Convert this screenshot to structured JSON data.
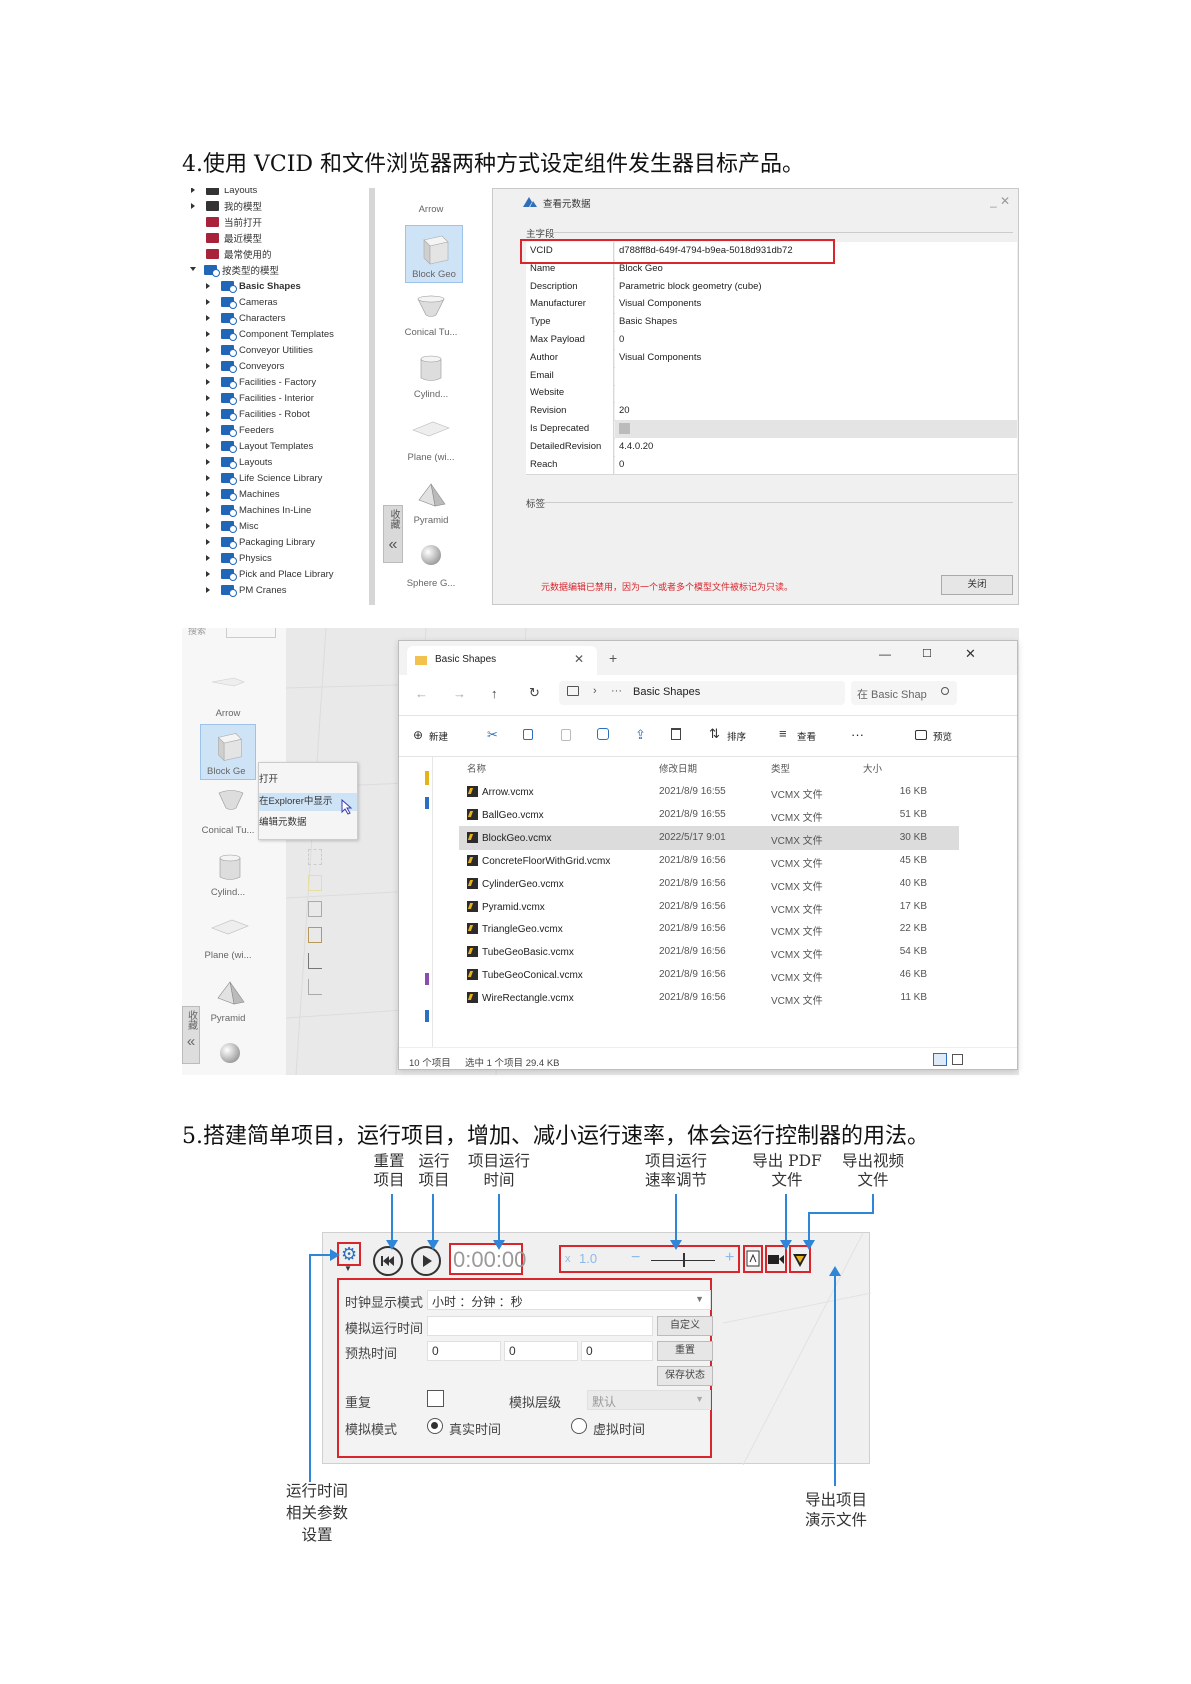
{
  "section4": {
    "heading": "4.使用 VCID 和文件浏览器两种方式设定组件发生器目标产品。",
    "tree": [
      {
        "label": "Layouts",
        "icon": "dark",
        "bold": false,
        "arrow": true
      },
      {
        "label": "我的模型",
        "icon": "dark",
        "bold": false,
        "arrow": true
      },
      {
        "label": "当前打开",
        "icon": "red",
        "bold": false,
        "arrow": false
      },
      {
        "label": "最近模型",
        "icon": "red",
        "bold": false,
        "arrow": false
      },
      {
        "label": "最常使用的",
        "icon": "red",
        "bold": false,
        "arrow": false
      },
      {
        "label": "按类型的模型",
        "icon": "blue",
        "bold": false,
        "arrow": "open"
      },
      {
        "label": "Basic Shapes",
        "icon": "blue",
        "bold": true,
        "arrow": true,
        "indent": true
      },
      {
        "label": "Cameras",
        "icon": "blue",
        "bold": false,
        "arrow": true,
        "indent": true
      },
      {
        "label": "Characters",
        "icon": "blue",
        "bold": false,
        "arrow": true,
        "indent": true
      },
      {
        "label": "Component Templates",
        "icon": "blue",
        "bold": false,
        "arrow": true,
        "indent": true
      },
      {
        "label": "Conveyor Utilities",
        "icon": "blue",
        "bold": false,
        "arrow": true,
        "indent": true
      },
      {
        "label": "Conveyors",
        "icon": "blue",
        "bold": false,
        "arrow": true,
        "indent": true
      },
      {
        "label": "Facilities - Factory",
        "icon": "blue",
        "bold": false,
        "arrow": true,
        "indent": true
      },
      {
        "label": "Facilities - Interior",
        "icon": "blue",
        "bold": false,
        "arrow": true,
        "indent": true
      },
      {
        "label": "Facilities - Robot",
        "icon": "blue",
        "bold": false,
        "arrow": true,
        "indent": true
      },
      {
        "label": "Feeders",
        "icon": "blue",
        "bold": false,
        "arrow": true,
        "indent": true
      },
      {
        "label": "Layout Templates",
        "icon": "blue",
        "bold": false,
        "arrow": true,
        "indent": true
      },
      {
        "label": "Layouts",
        "icon": "blue",
        "bold": false,
        "arrow": true,
        "indent": true
      },
      {
        "label": "Life Science Library",
        "icon": "blue",
        "bold": false,
        "arrow": true,
        "indent": true
      },
      {
        "label": "Machines",
        "icon": "blue",
        "bold": false,
        "arrow": true,
        "indent": true
      },
      {
        "label": "Machines In-Line",
        "icon": "blue",
        "bold": false,
        "arrow": true,
        "indent": true
      },
      {
        "label": "Misc",
        "icon": "blue",
        "bold": false,
        "arrow": true,
        "indent": true
      },
      {
        "label": "Packaging Library",
        "icon": "blue",
        "bold": false,
        "arrow": true,
        "indent": true
      },
      {
        "label": "Physics",
        "icon": "blue",
        "bold": false,
        "arrow": true,
        "indent": true
      },
      {
        "label": "Pick and Place Library",
        "icon": "blue",
        "bold": false,
        "arrow": true,
        "indent": true
      },
      {
        "label": "PM Cranes",
        "icon": "blue",
        "bold": false,
        "arrow": true,
        "indent": true
      }
    ],
    "shapes_top": [
      "Arrow",
      "Block Geo",
      "Conical Tu...",
      "Cylind...",
      "Plane (wi...",
      "Pyramid",
      "Sphere G..."
    ],
    "sidebar_tab": "收藏",
    "collapse_glyph": "«",
    "dialog": {
      "title": "查看元数据",
      "section_main": "主字段",
      "rows": [
        {
          "key": "VCID",
          "value": "d788ff8d-649f-4794-b9ea-5018d931db72"
        },
        {
          "key": "Name",
          "value": "Block Geo"
        },
        {
          "key": "Description",
          "value": "Parametric block geometry (cube)"
        },
        {
          "key": "Manufacturer",
          "value": "Visual Components"
        },
        {
          "key": "Type",
          "value": "Basic Shapes"
        },
        {
          "key": "Max Payload",
          "value": "0"
        },
        {
          "key": "Author",
          "value": "Visual Components"
        },
        {
          "key": "Email",
          "value": ""
        },
        {
          "key": "Website",
          "value": ""
        },
        {
          "key": "Revision",
          "value": "20"
        },
        {
          "key": "Is Deprecated",
          "value": ""
        },
        {
          "key": "DetailedRevision",
          "value": "4.4.0.20"
        },
        {
          "key": "Reach",
          "value": "0"
        }
      ],
      "section_tags": "标签",
      "notice": "元数据编辑已禁用，因为一个或者多个模型文件被标记为只读。",
      "close": "关闭",
      "window_controls": "_ ✕"
    },
    "left_pane": {
      "search_stub": "搜索",
      "shapes": [
        "Arrow",
        "Block Ge",
        "Conical Tu...",
        "Cylind...",
        "Plane (wi...",
        "Pyramid"
      ],
      "sidebar_tab": "收藏"
    },
    "context_menu": [
      "打开",
      "在Explorer中显示",
      "编辑元数据"
    ],
    "explorer": {
      "tab": "Basic Shapes",
      "new_tab": "+",
      "win_min": "—",
      "win_max": "☐",
      "win_close": "✕",
      "path_more": "···",
      "path": "Basic Shapes",
      "search_placeholder": "在 Basic Shap",
      "toolbar": {
        "new": "新建",
        "sort": "排序",
        "view": "查看",
        "more": "···",
        "preview": "预览"
      },
      "columns": {
        "name": "名称",
        "modified": "修改日期",
        "type": "类型",
        "size": "大小"
      },
      "files": [
        {
          "name": "Arrow.vcmx",
          "modified": "2021/8/9 16:55",
          "type": "VCMX 文件",
          "size": "16 KB"
        },
        {
          "name": "BallGeo.vcmx",
          "modified": "2021/8/9 16:55",
          "type": "VCMX 文件",
          "size": "51 KB"
        },
        {
          "name": "BlockGeo.vcmx",
          "modified": "2022/5/17 9:01",
          "type": "VCMX 文件",
          "size": "30 KB"
        },
        {
          "name": "ConcreteFloorWithGrid.vcmx",
          "modified": "2021/8/9 16:56",
          "type": "VCMX 文件",
          "size": "45 KB"
        },
        {
          "name": "CylinderGeo.vcmx",
          "modified": "2021/8/9 16:56",
          "type": "VCMX 文件",
          "size": "40 KB"
        },
        {
          "name": "Pyramid.vcmx",
          "modified": "2021/8/9 16:56",
          "type": "VCMX 文件",
          "size": "17 KB"
        },
        {
          "name": "TriangleGeo.vcmx",
          "modified": "2021/8/9 16:56",
          "type": "VCMX 文件",
          "size": "22 KB"
        },
        {
          "name": "TubeGeoBasic.vcmx",
          "modified": "2021/8/9 16:56",
          "type": "VCMX 文件",
          "size": "54 KB"
        },
        {
          "name": "TubeGeoConical.vcmx",
          "modified": "2021/8/9 16:56",
          "type": "VCMX 文件",
          "size": "46 KB"
        },
        {
          "name": "WireRectangle.vcmx",
          "modified": "2021/8/9 16:56",
          "type": "VCMX 文件",
          "size": "11 KB"
        }
      ],
      "selected_index": 2,
      "status_count": "10 个项目",
      "status_selected": "选中 1 个项目  29.4 KB"
    }
  },
  "section5": {
    "heading": "5.搭建简单项目，运行项目，增加、减小运行速率，体会运行控制器的用法。",
    "callouts": {
      "reset": "重置\n项目",
      "run": "运行\n项目",
      "runtime": "项目运行\n时间",
      "speed": "项目运行\n速率调节",
      "pdf": "导出 PDF\n文件",
      "video": "导出视频\n文件",
      "params": "运行时间\n相关参数\n设置",
      "demo": "导出项目\n演示文件"
    },
    "controller": {
      "time_display": "0:00:00",
      "speed_prefix": "x",
      "speed_value": "1.0",
      "minus": "−",
      "plus": "+",
      "clock_mode_label": "时钟显示模式",
      "clock_mode_value": "小时          ：分钟          ：秒",
      "sim_time_label": "模拟运行时间",
      "warmup_label": "预热时间",
      "warmup_values": [
        "0",
        "0",
        "0"
      ],
      "btn_custom": "自定义",
      "btn_reset": "重置",
      "btn_save": "保存状态",
      "repeat_label": "重复",
      "sim_level_label": "模拟层级",
      "sim_level_value": "默认",
      "sim_mode_label": "模拟模式",
      "realtime": "真实时间",
      "virtual": "虚拟时间"
    }
  }
}
